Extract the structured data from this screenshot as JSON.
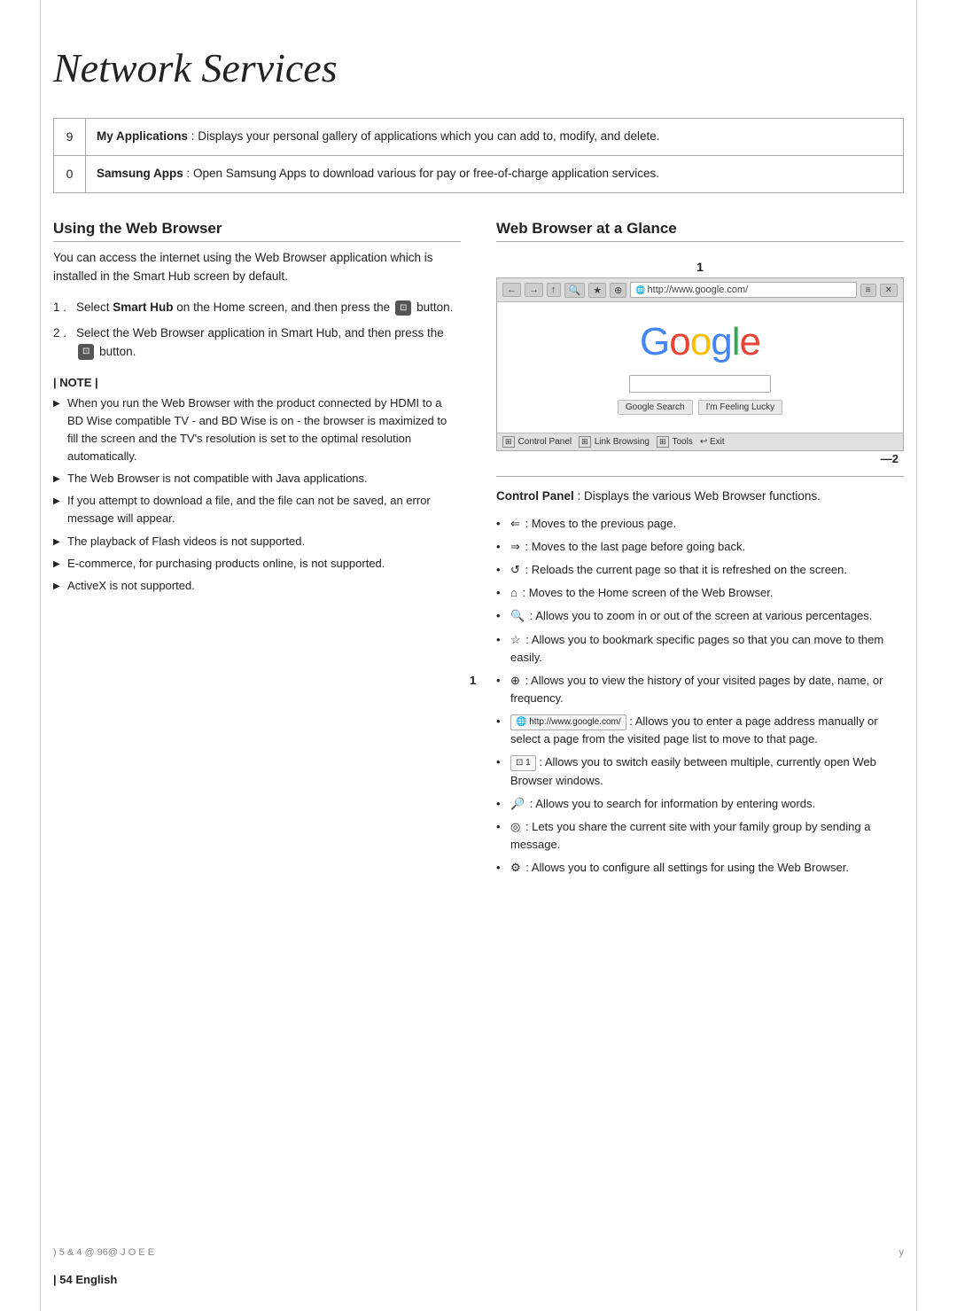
{
  "page": {
    "title": "Network Services",
    "footer": {
      "page_indicator": "| 54",
      "language": "English",
      "bottom_code": ") 5 & 4   @ 96@   J O E E",
      "page_right": "y"
    }
  },
  "table": {
    "rows": [
      {
        "number": "9",
        "label": "My Applications",
        "text": " : Displays your personal gallery of applications which you can add to, modify, and delete."
      },
      {
        "number": "0",
        "label": "Samsung Apps",
        "text": " : Open Samsung Apps to download various for pay or free-of-charge application services."
      }
    ]
  },
  "using_web_browser": {
    "heading": "Using the Web Browser",
    "intro": "You can access the internet using the Web Browser application which is installed in the Smart Hub screen by default.",
    "steps": [
      {
        "number": "1 .",
        "text_before": "Select ",
        "bold": "Smart Hub",
        "text_after": " on the Home screen, and then press the",
        "icon": "⊡",
        "text_end": "button."
      },
      {
        "number": "2 .",
        "text_before": "Select the Web Browser application in Smart Hub, and then press the",
        "icon": "⊡",
        "text_end": "button."
      }
    ],
    "note_label": "| NOTE |",
    "notes": [
      "When you run the Web Browser with the product connected by HDMI to a BD Wise compatible TV - and BD Wise is on - the browser is maximized to fill the screen and the TV's resolution is set to the optimal resolution automatically.",
      "The Web Browser is not compatible with Java applications.",
      "If you attempt to download a file, and the file can not be saved, an error message will appear.",
      "The playback of Flash videos is not supported.",
      "E-commerce, for purchasing products online, is not supported.",
      "ActiveX is not supported."
    ]
  },
  "web_browser_glance": {
    "heading": "Web Browser at a Glance",
    "callout_1": "1",
    "callout_2": "—2",
    "browser": {
      "url": "http://www.google.com/",
      "nav_buttons": [
        "←",
        "→",
        "↑",
        "🔍",
        "★",
        "⊕"
      ],
      "right_buttons": [
        "≡",
        "✕"
      ],
      "google_logo": "Google",
      "search_bar": "",
      "btn1": "Google Search",
      "btn2": "I'm Feeling Lucky",
      "statusbar": [
        "⊞ Control Panel",
        "⊞ Link Browsing",
        "⊞ Tools",
        "↩ Exit"
      ]
    },
    "control_panel_section": {
      "label": "Control Panel",
      "label_suffix": " : Displays the various Web Browser functions.",
      "callout_1_label": "1",
      "bullets": [
        {
          "icon": "⇐",
          "text": ": Moves to the previous page."
        },
        {
          "icon": "⇒",
          "text": ": Moves to the last page before going back."
        },
        {
          "icon": "↺",
          "text": ": Reloads the current page so that it is refreshed on the screen."
        },
        {
          "icon": "⌂",
          "text": ": Moves to the Home screen of the Web Browser."
        },
        {
          "icon": "🔍",
          "text": ": Allows you to zoom in or out of the screen at various percentages."
        },
        {
          "icon": "☆",
          "text": ": Allows you to bookmark specific pages so that you can move to them easily."
        },
        {
          "icon": "⊕",
          "text": ": Allows you to view the history of your visited pages by date, name, or frequency."
        },
        {
          "icon_url": "http://www.google.com/",
          "text": ": Allows you to enter a page address manually or select a page from the visited page list to move to that page."
        },
        {
          "icon_tab": "⊡ 1",
          "text": ": Allows you to switch easily between multiple, currently open Web Browser windows."
        },
        {
          "icon": "🔎",
          "text": ": Allows you to search for information by entering words."
        },
        {
          "icon": "◎",
          "text": ": Lets you share the current site with your family group by sending a message."
        },
        {
          "icon": "⚙",
          "text": ": Allows you to configure all settings for using the Web Browser."
        }
      ]
    }
  }
}
